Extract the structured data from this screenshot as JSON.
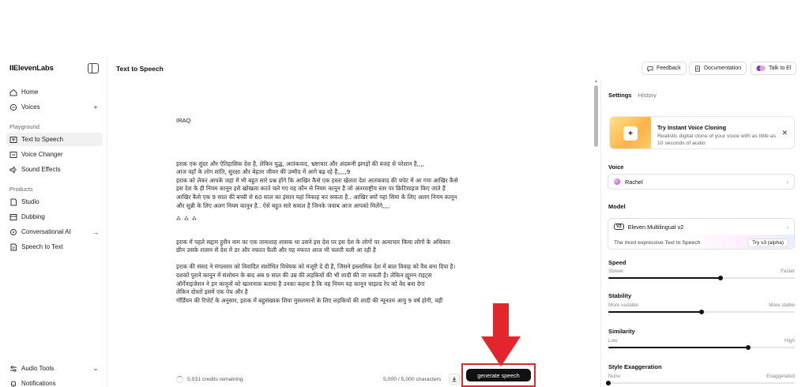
{
  "sidebar": {
    "brand": "IIElevenLabs",
    "items_top": [
      {
        "label": "Home",
        "icon": "home-icon"
      },
      {
        "label": "Voices",
        "icon": "voices-icon",
        "trail": "+"
      }
    ],
    "section_playground": "Playground",
    "items_playground": [
      {
        "label": "Text to Speech",
        "icon": "text-to-speech-icon",
        "active": true
      },
      {
        "label": "Voice Changer",
        "icon": "voice-changer-icon"
      },
      {
        "label": "Sound Effects",
        "icon": "sound-effects-icon"
      }
    ],
    "section_products": "Products",
    "items_products": [
      {
        "label": "Studio",
        "icon": "studio-icon"
      },
      {
        "label": "Dubbing",
        "icon": "dubbing-icon"
      },
      {
        "label": "Conversational AI",
        "icon": "conversational-ai-icon",
        "trail": "→"
      },
      {
        "label": "Speech to Text",
        "icon": "speech-to-text-icon"
      }
    ],
    "items_bottom": [
      {
        "label": "Audio Tools",
        "icon": "audio-tools-icon",
        "trail": "⌄"
      },
      {
        "label": "Notifications",
        "icon": "bell-icon"
      }
    ]
  },
  "header": {
    "title": "Text to Speech",
    "feedback": "Feedback",
    "documentation": "Documentation",
    "talk": "Talk to El"
  },
  "editor": {
    "title_line": "IRAQ",
    "para1": [
      "इराक़ एक सुंदर और ऐतिहासिक देश है, लेकिन युद्ध, आतंकवाद, भ्रष्टाचार और अंदरूनी झगड़ों की वजह से परेशान है,,,,",
      "आज वहाँ के लोग शांति, सुरक्षा और बेहतर जीवन की उम्मीद में आगे बढ़ रहे हैं,,,,,9",
      "इराक को लेकर आपके जहां में भी बहुत सारे प्रश्न होंगे कि आखिर कैसे एक हस्ता खेलता देश आतंकवाद की चपेट में आ गया आखिर कैसे",
      "इस देश के ही नियम कानून इसे खोखला करते चले गए वह कौन से नियम कानून है जो अंतरराष्ट्रीय स्तर पर क्रिटिसाइज किए जाते हैं",
      "आखिर कैसे एक 9 साल की बच्ची से 60 साल का इंसान यहां निकाह कर सकता है.. आखिर क्यों यहां सिया के लिए अलग नियम कानून",
      "और सुन्नी के लिए अलग नियम कानून है.. ऐसे बहुत सारे सवाल है जिनके जवाब आज आपको मिलेंगे,,,,"
    ],
    "separator": "⁂ ⁂ ⁂",
    "para2": [
      "इराक में पहले सद्दाम हुसैन नाम का एक तानाशाह शासक था उसने इस देश पर इस देश के लोगों पर अत्याचार किया लोगों के अधिकार",
      "छीन उसके शासन से देश में डर और नफरत फैली और यह नफरत आज भी चलती चली आ रही है"
    ],
    "para3": [
      "इराक की संसद ने मंगलवार को विवादित संशोधित विधेयक को मंजूरी दे दी है, जिसने इस्लामिक देश में बाल विवाह को वैध बना दिया है।",
      "दशकों पुराने कानून में संशोधन के बाद अब 9 साल की उम्र की लड़कियों की भी शादी की जा सकती है। लेकिन ह्यूमन राइट्स",
      "ऑर्गेनाइजेशन ने इन कानूनों को खतरनाक बताया है उनका कहना है कि यह नियम यह कानून चाइल्ड रेप को वेद बना देगा",
      "लेकिन दोस्तों इसमें एक पेच और है",
      "गॉर्डियन की रिपोर्ट के अनुसार, इराक में बहुसंख्यक शिया मुसलमानों के लिए लड़कियों की शादी की न्यूनतम आयु 9 वर्ष होगी, वहीं"
    ],
    "credits": "5,031 credits remaining",
    "chars": "5,000 / 5,000 characters",
    "generate": "generate speech"
  },
  "settings": {
    "tab_settings": "Settings",
    "tab_history": "History",
    "promo_title": "Try Instant Voice Cloning",
    "promo_desc": "Realistic digital clone of your voice with as little as 10 seconds of audio",
    "voice_label": "Voice",
    "voice_value": "Rachel",
    "model_label": "Model",
    "model_badge": "V2",
    "model_value": "Eleven Multilingual v2",
    "model_sub": "The most expressive Text to Speech",
    "model_try": "Try v3 (alpha)",
    "sliders": [
      {
        "label": "Speed",
        "min": "Slower",
        "max": "Faster",
        "value": 0.6
      },
      {
        "label": "Stability",
        "min": "More variable",
        "max": "More stable",
        "value": 0.5
      },
      {
        "label": "Similarity",
        "min": "Low",
        "max": "High",
        "value": 0.75
      },
      {
        "label": "Style Exaggeration",
        "min": "None",
        "max": "Exaggerated",
        "value": 0.0
      }
    ]
  },
  "colors": {
    "accent_red": "#e3262c",
    "primary": "#111111"
  }
}
